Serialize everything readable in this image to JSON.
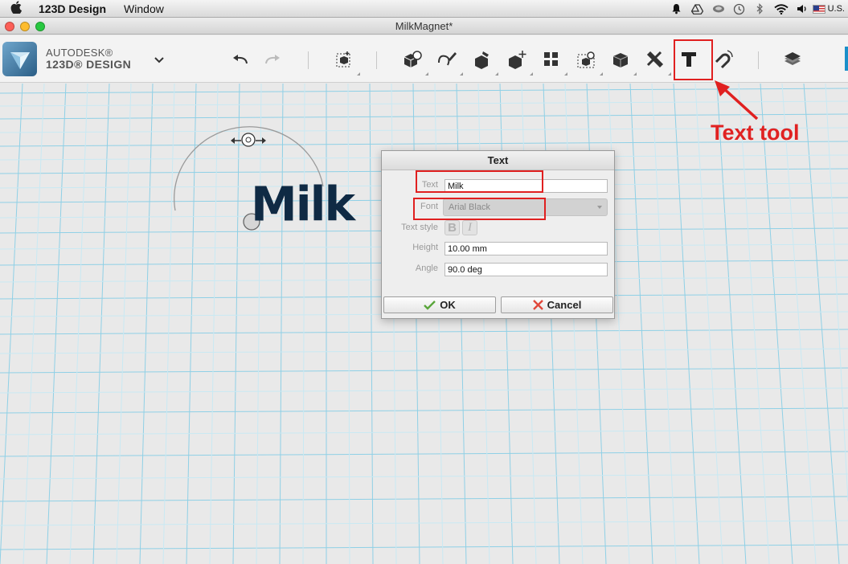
{
  "menubar": {
    "app_name": "123D Design",
    "menus": [
      "Window"
    ],
    "locale": "U.S."
  },
  "window": {
    "title": "MilkMagnet*"
  },
  "brand": {
    "line1": "AUTODESK®",
    "line2": "123D® DESIGN"
  },
  "toolbar": {
    "tools": [
      "undo-icon",
      "redo-icon",
      "transform-icon",
      "primitives-icon",
      "sketch-icon",
      "construct-icon",
      "modify-icon",
      "pattern-icon",
      "grouping-icon",
      "combine-icon",
      "measure-icon",
      "text-icon",
      "snap-icon",
      "material-icon"
    ]
  },
  "canvas": {
    "object_text": "Milk"
  },
  "dialog": {
    "title": "Text",
    "text_label": "Text",
    "text_value": "Milk",
    "font_label": "Font",
    "font_value": "Arial Black",
    "style_label": "Text style",
    "bold_glyph": "B",
    "italic_glyph": "I",
    "height_label": "Height",
    "height_value": "10.00 mm",
    "angle_label": "Angle",
    "angle_value": "90.0 deg",
    "ok_label": "OK",
    "cancel_label": "Cancel"
  },
  "annotation": {
    "label": "Text tool",
    "color": "#e02020"
  },
  "colors": {
    "grid_line": "#8fd0e6",
    "text_object": "#0f2a44",
    "accent": "#1a8fc9"
  }
}
